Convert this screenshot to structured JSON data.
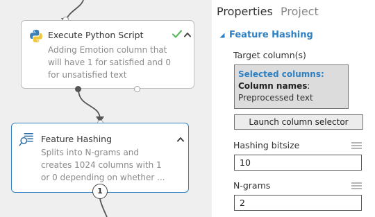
{
  "canvas": {
    "modules": [
      {
        "title": "Execute Python Script",
        "description_lines": [
          "Adding Emotion column that",
          "will have 1 for  satisfied and 0",
          "for unsatisfied text"
        ],
        "icon": "python-icon",
        "status_icon": "check-icon",
        "selected": false
      },
      {
        "title": "Feature Hashing",
        "description_lines": [
          "Splits into  N-grams and",
          "creates 1024 columns with 1",
          "or 0 depending on whether  ..."
        ],
        "icon": "feature-hashing-icon",
        "selected": true
      }
    ],
    "output_port_badge": "1",
    "colors": {
      "canvas_bg": "#efefef",
      "selected_border": "#2f80c2",
      "status_ok": "#5cb85c"
    }
  },
  "properties": {
    "tabs": [
      {
        "label": "Properties",
        "active": true
      },
      {
        "label": "Project",
        "active": false
      }
    ],
    "section_title": "Feature Hashing",
    "target_column": {
      "label": "Target column(s)",
      "selected_header": "Selected columns:",
      "names_label": "Column names",
      "names_sep": ":",
      "value": "Preprocessed text"
    },
    "launch_button": "Launch column selector",
    "hashing_bitsize": {
      "label": "Hashing bitsize",
      "value": "10"
    },
    "ngrams": {
      "label": "N-grams",
      "value": "2"
    },
    "accent_color": "#2f80c2"
  }
}
